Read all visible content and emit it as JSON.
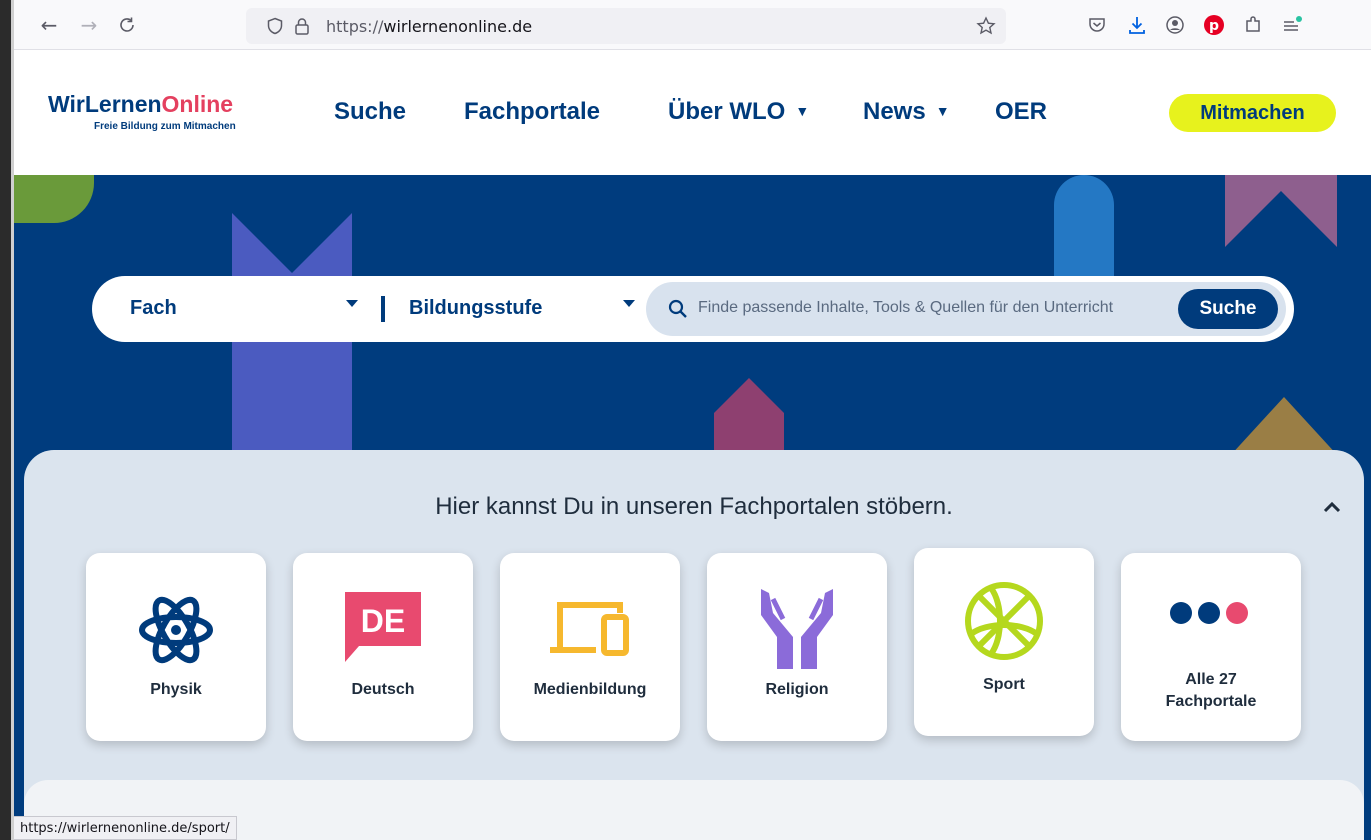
{
  "browser": {
    "url_protocol": "https://",
    "url_host": "wirlernenonline.de",
    "status_url": "https://wirlernenonline.de/sport/"
  },
  "header": {
    "logo_part1": "WirLernen",
    "logo_part2": "Online",
    "logo_tagline": "Freie Bildung zum Mitmachen",
    "nav": [
      "Suche",
      "Fachportale",
      "Über WLO",
      "News",
      "OER"
    ],
    "cta": "Mitmachen"
  },
  "search": {
    "subject_label": "Fach",
    "level_label": "Bildungsstufe",
    "placeholder": "Finde passende Inhalte, Tools & Quellen für den Unterricht",
    "button": "Suche"
  },
  "portals": {
    "title": "Hier kannst Du in unseren Fachportalen stöbern.",
    "cards": [
      {
        "label": "Physik",
        "icon": "atom-icon"
      },
      {
        "label": "Deutsch",
        "icon": "speech-de-icon",
        "icon_text": "DE"
      },
      {
        "label": "Medienbildung",
        "icon": "devices-icon"
      },
      {
        "label": "Religion",
        "icon": "hands-icon"
      },
      {
        "label": "Sport",
        "icon": "ball-icon"
      },
      {
        "label": "Alle 27 Fachportale",
        "line1": "Alle 27",
        "line2": "Fachportale",
        "icon": "dots-icon"
      }
    ]
  },
  "colors": {
    "brand_blue": "#003b7c",
    "brand_pink": "#e4405f",
    "cta_yellow": "#e7f21d",
    "hero_bg": "#003c7e"
  }
}
